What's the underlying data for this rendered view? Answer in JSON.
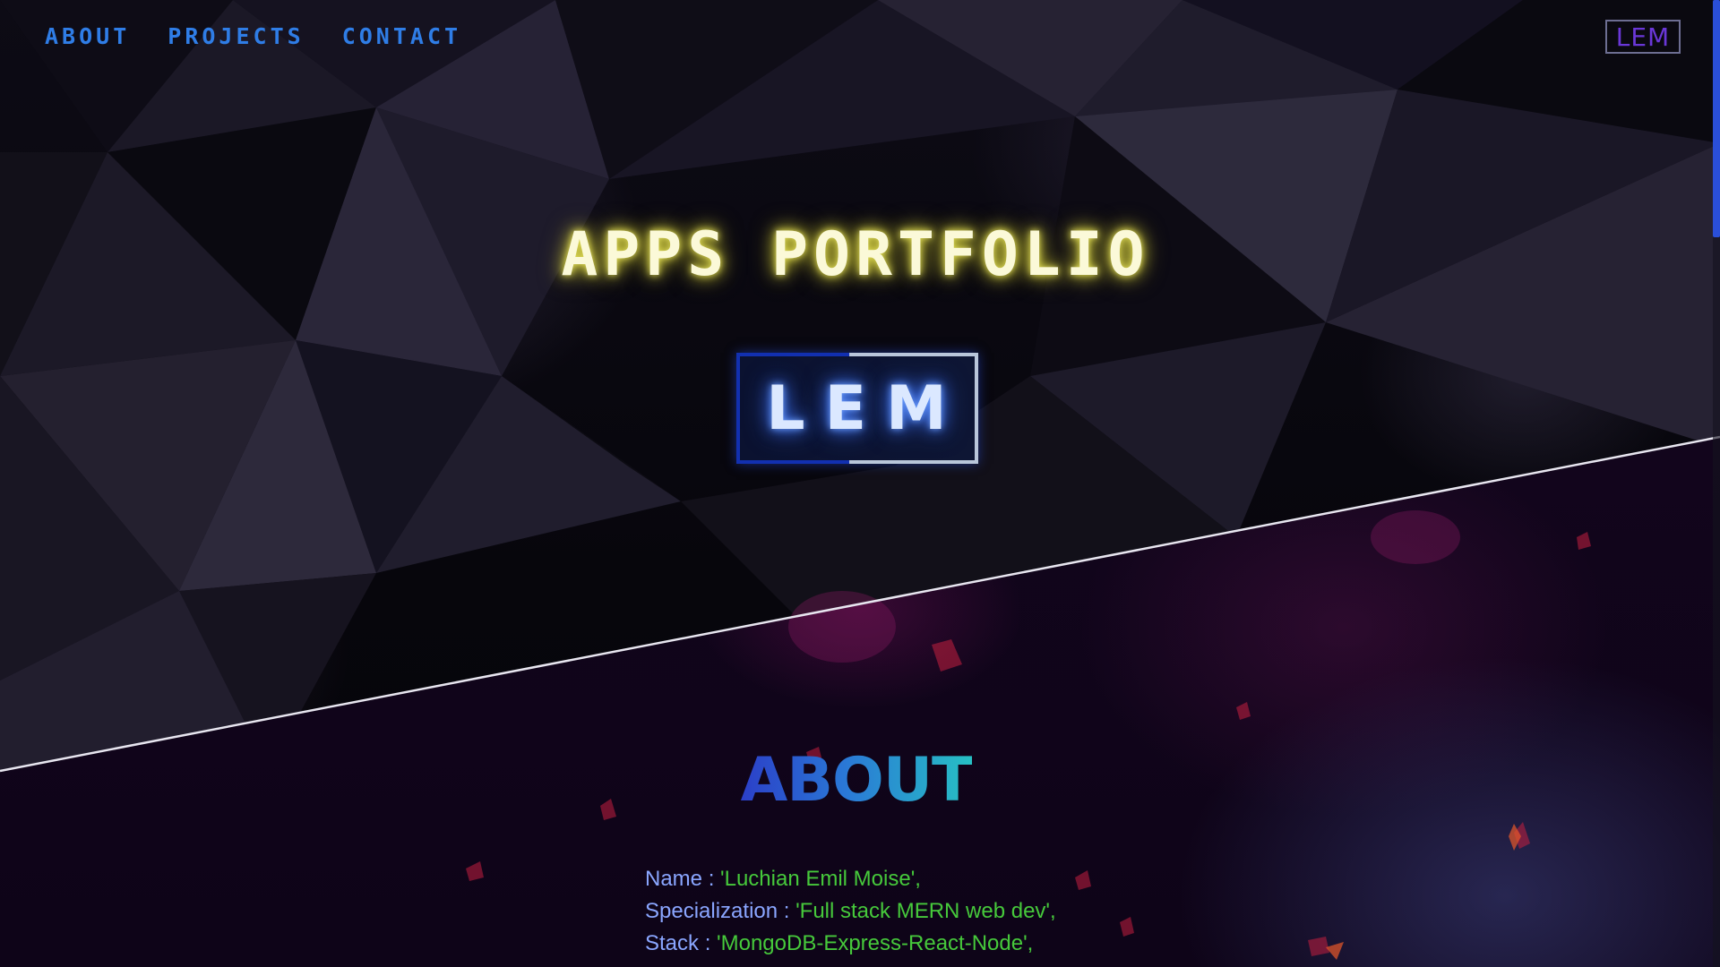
{
  "nav": {
    "items": [
      {
        "label": "ABOUT"
      },
      {
        "label": "PROJECTS"
      },
      {
        "label": "CONTACT"
      }
    ]
  },
  "corner_logo": {
    "text": "LEM"
  },
  "hero": {
    "title": "APPS PORTFOLIO",
    "logo_text": "LEM"
  },
  "about": {
    "heading": "ABOUT",
    "lines": [
      {
        "key": "Name : ",
        "value": "'Luchian Emil Moise',"
      },
      {
        "key": "Specialization : ",
        "value": "'Full stack MERN web dev',"
      },
      {
        "key": "Stack : ",
        "value": "'MongoDB-Express-React-Node',"
      }
    ]
  },
  "colors": {
    "nav": "#2f7de6",
    "title_glow": "#e7e35b",
    "logo_glow": "#3a6ff0",
    "about_key": "#8aa6ff",
    "about_value": "#46c93b"
  }
}
